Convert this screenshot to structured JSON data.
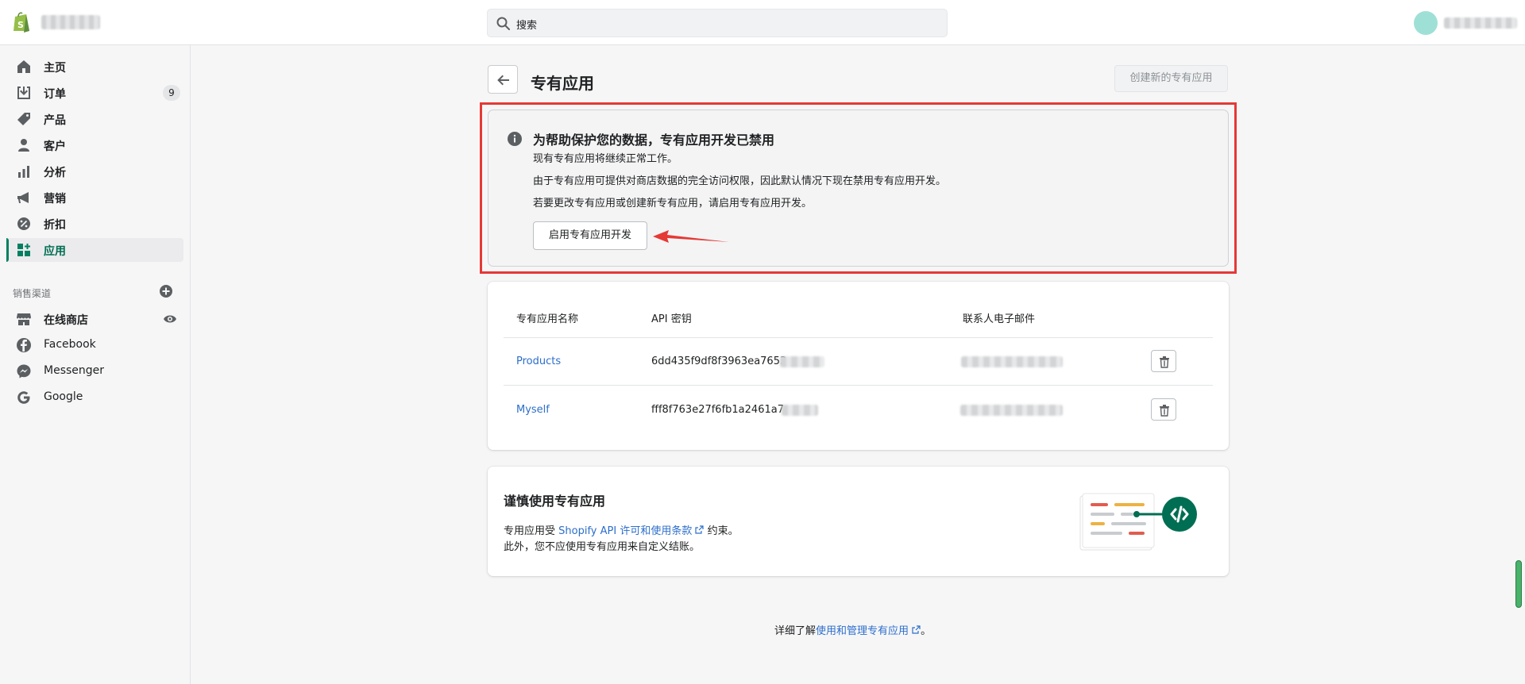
{
  "topbar": {
    "search_placeholder": "搜索"
  },
  "sidebar": {
    "items": [
      {
        "label": "主页"
      },
      {
        "label": "订单",
        "badge": "9"
      },
      {
        "label": "产品"
      },
      {
        "label": "客户"
      },
      {
        "label": "分析"
      },
      {
        "label": "营销"
      },
      {
        "label": "折扣"
      },
      {
        "label": "应用"
      }
    ],
    "sales_channels_title": "销售渠道",
    "channels": [
      {
        "label": "在线商店"
      },
      {
        "label": "Facebook"
      },
      {
        "label": "Messenger"
      },
      {
        "label": "Google"
      }
    ]
  },
  "page": {
    "title": "专有应用",
    "create_button": "创建新的专有应用"
  },
  "notice": {
    "title": "为帮助保护您的数据，专有应用开发已禁用",
    "lines": [
      "现有专有应用将继续正常工作。",
      "由于专有应用可提供对商店数据的完全访问权限，因此默认情况下现在禁用专有应用开发。",
      "若要更改专有应用或创建新专有应用，请启用专有应用开发。"
    ],
    "button": "启用专有应用开发"
  },
  "table": {
    "headers": [
      "专有应用名称",
      "API 密钥",
      "联系人电子邮件"
    ],
    "rows": [
      {
        "name": "Products",
        "api_key": "6dd435f9df8f3963ea7653"
      },
      {
        "name": "Myself",
        "api_key": "fff8f763e27f6fb1a2461a7"
      }
    ]
  },
  "caution": {
    "title": "谨慎使用专有应用",
    "line1_prefix": "专用应用受 ",
    "line1_link": "Shopify API 许可和使用条款",
    "line1_suffix": " 约束。",
    "line2": "此外，您不应使用专有应用来自定义结账。"
  },
  "footer": {
    "prefix": "详细了解",
    "link": "使用和管理专有应用",
    "suffix": "。"
  },
  "colors": {
    "accent": "#008060",
    "link": "#2c6ecb",
    "highlight": "#e53935"
  }
}
